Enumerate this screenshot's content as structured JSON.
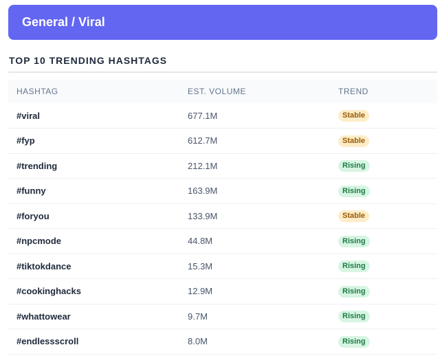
{
  "header": {
    "title": "General / Viral"
  },
  "section": {
    "title": "TOP 10 TRENDING HASHTAGS"
  },
  "table": {
    "columns": [
      "HASHTAG",
      "EST. VOLUME",
      "TREND"
    ],
    "rows": [
      {
        "hashtag": "#viral",
        "volume": "677.1M",
        "trend": "Stable"
      },
      {
        "hashtag": "#fyp",
        "volume": "612.7M",
        "trend": "Stable"
      },
      {
        "hashtag": "#trending",
        "volume": "212.1M",
        "trend": "Rising"
      },
      {
        "hashtag": "#funny",
        "volume": "163.9M",
        "trend": "Rising"
      },
      {
        "hashtag": "#foryou",
        "volume": "133.9M",
        "trend": "Stable"
      },
      {
        "hashtag": "#npcmode",
        "volume": "44.8M",
        "trend": "Rising"
      },
      {
        "hashtag": "#tiktokdance",
        "volume": "15.3M",
        "trend": "Rising"
      },
      {
        "hashtag": "#cookinghacks",
        "volume": "12.9M",
        "trend": "Rising"
      },
      {
        "hashtag": "#whattowear",
        "volume": "9.7M",
        "trend": "Rising"
      },
      {
        "hashtag": "#endlessscroll",
        "volume": "8.0M",
        "trend": "Rising"
      }
    ]
  },
  "colors": {
    "banner": "#6366f1",
    "stable_bg": "#fdecc8",
    "stable_text": "#9a5a06",
    "rising_bg": "#d7f5e3",
    "rising_text": "#1e7a45"
  }
}
